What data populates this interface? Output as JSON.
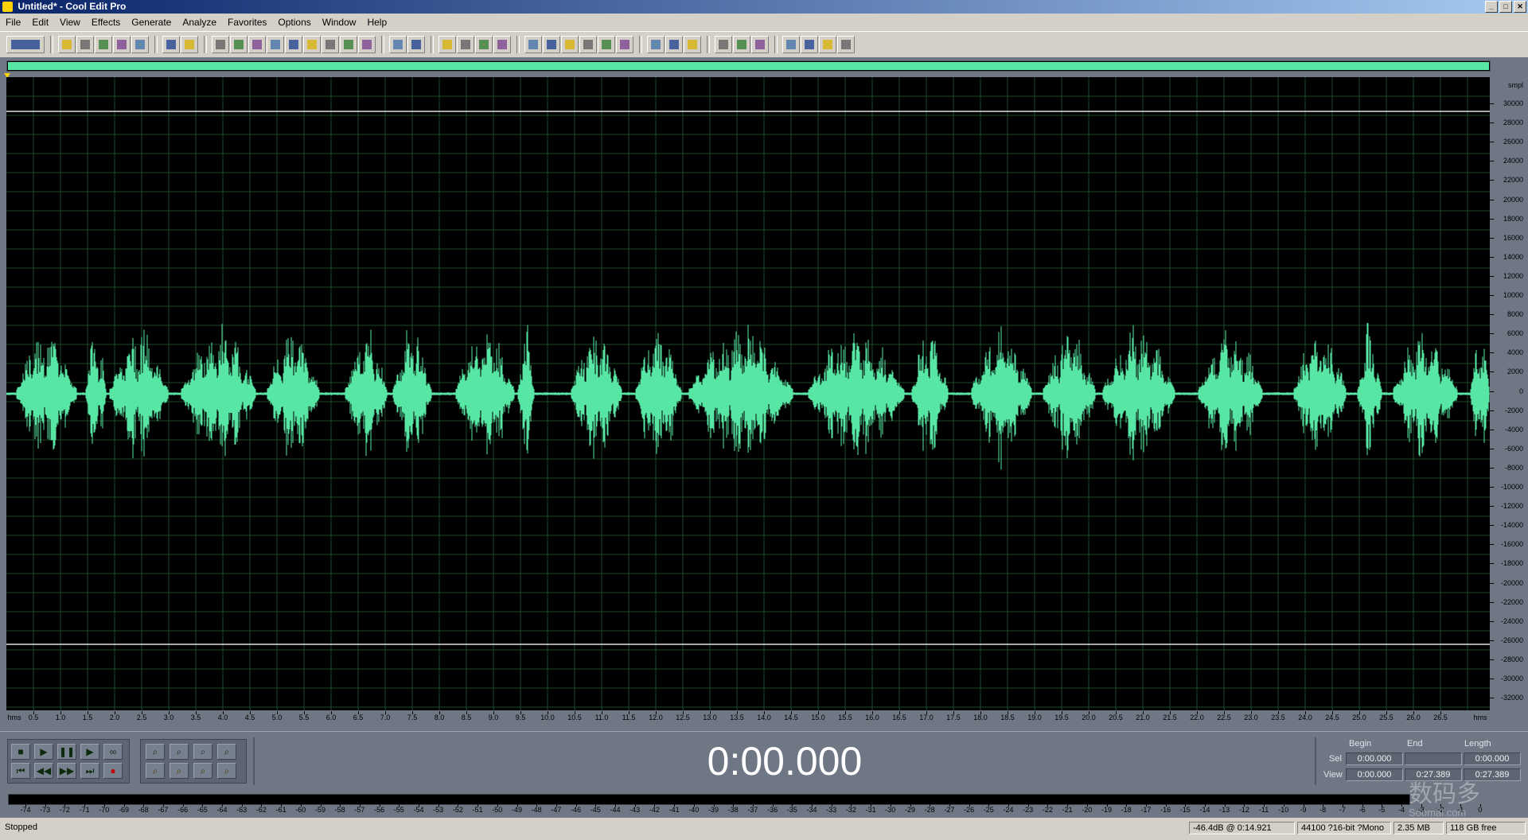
{
  "window": {
    "title": "Untitled* - Cool Edit Pro",
    "icon": "cool-edit-app-icon",
    "controls": [
      "_",
      "□",
      "✕"
    ]
  },
  "menu": [
    "File",
    "Edit",
    "View",
    "Effects",
    "Generate",
    "Analyze",
    "Favorites",
    "Options",
    "Window",
    "Help"
  ],
  "toolbar": {
    "icons": [
      "mode-switch-icon",
      "new-icon",
      "open-icon",
      "save-icon",
      "save-as-icon",
      "close-icon",
      "undo-icon",
      "redo-icon",
      "repeat-icon",
      "copy-icon",
      "copy-new-icon",
      "cut-icon",
      "paste-icon",
      "paste-new-icon",
      "mix-paste-icon",
      "crop-icon",
      "trim-icon",
      "zoom-selection-icon",
      "envelope-icon",
      "waveform-view-icon",
      "spectral-view-icon",
      "loop-icon",
      "cue-list-icon",
      "settings-icon",
      "snap-icon",
      "time-format-icon",
      "display-icon",
      "metronome-icon",
      "info-icon",
      "frequency-analysis-icon",
      "statistics-icon",
      "help-icon",
      "scripts-icon",
      "amplify-icon",
      "normalize-icon",
      "noise-reduction-icon",
      "filter-icon",
      "effects-rack-icon",
      "graphic-eq-icon"
    ]
  },
  "waveform": {
    "overview_color": "#58e6a5",
    "wave_color": "#58e6a5",
    "background": "#000000",
    "grid_color": "#1c4a2c",
    "amplitude_unit": "smpl",
    "amplitude_labels": [
      "30000",
      "28000",
      "26000",
      "24000",
      "22000",
      "20000",
      "18000",
      "16000",
      "14000",
      "12000",
      "10000",
      "8000",
      "6000",
      "4000",
      "2000",
      "0",
      "-2000",
      "-4000",
      "-6000",
      "-8000",
      "-10000",
      "-12000",
      "-14000",
      "-16000",
      "-18000",
      "-20000",
      "-22000",
      "-24000",
      "-26000",
      "-28000",
      "-30000",
      "-32000"
    ],
    "time_unit": "hms",
    "time_labels": [
      "0.5",
      "1.0",
      "1.5",
      "2.0",
      "2.5",
      "3.0",
      "3.5",
      "4.0",
      "4.5",
      "5.0",
      "5.5",
      "6.0",
      "6.5",
      "7.0",
      "7.5",
      "8.0",
      "8.5",
      "9.0",
      "9.5",
      "10.0",
      "10.5",
      "11.0",
      "11.5",
      "12.0",
      "12.5",
      "13.0",
      "13.5",
      "14.0",
      "14.5",
      "15.0",
      "15.5",
      "16.0",
      "16.5",
      "17.0",
      "17.5",
      "18.0",
      "18.5",
      "19.0",
      "19.5",
      "20.0",
      "20.5",
      "21.0",
      "21.5",
      "22.0",
      "22.5",
      "23.0",
      "23.5",
      "24.0",
      "24.5",
      "25.0",
      "25.5",
      "26.0",
      "26.5"
    ]
  },
  "transport": {
    "icons": [
      "stop-icon",
      "play-icon",
      "pause-icon",
      "play-to-end-icon",
      "loop-play-icon",
      "go-to-start-icon",
      "rewind-icon",
      "fast-forward-icon",
      "go-to-end-icon",
      "record-icon"
    ],
    "glyphs": [
      "■",
      "▶",
      "❚❚",
      "▶",
      "∞",
      "⏮",
      "◀◀",
      "▶▶",
      "⏭",
      "●"
    ]
  },
  "zoom": {
    "icons": [
      "zoom-in-icon",
      "zoom-out-icon",
      "zoom-full-icon",
      "zoom-in-vertical-icon",
      "zoom-left-icon",
      "zoom-right-icon",
      "zoom-selection-icon",
      "zoom-out-vertical-icon"
    ]
  },
  "time_display": "0:00.000",
  "selection": {
    "headers": {
      "begin": "Begin",
      "end": "End",
      "length": "Length"
    },
    "sel": {
      "label": "Sel",
      "begin": "0:00.000",
      "end": "",
      "length": "0:00.000"
    },
    "view": {
      "label": "View",
      "begin": "0:00.000",
      "end": "0:27.389",
      "length": "0:27.389"
    }
  },
  "level_labels": [
    "-74",
    "-73",
    "-72",
    "-71",
    "-70",
    "-69",
    "-68",
    "-67",
    "-66",
    "-65",
    "-64",
    "-63",
    "-62",
    "-61",
    "-60",
    "-59",
    "-58",
    "-57",
    "-56",
    "-55",
    "-54",
    "-53",
    "-52",
    "-51",
    "-50",
    "-49",
    "-48",
    "-47",
    "-46",
    "-45",
    "-44",
    "-43",
    "-42",
    "-41",
    "-40",
    "-39",
    "-38",
    "-37",
    "-36",
    "-35",
    "-34",
    "-33",
    "-32",
    "-31",
    "-30",
    "-29",
    "-28",
    "-27",
    "-26",
    "-25",
    "-24",
    "-23",
    "-22",
    "-21",
    "-20",
    "-19",
    "-18",
    "-17",
    "-16",
    "-15",
    "-14",
    "-13",
    "-12",
    "-11",
    "-10",
    "-9",
    "-8",
    "-7",
    "-6",
    "-5",
    "-4",
    "-3",
    "-2",
    "-1",
    "0"
  ],
  "status": {
    "state": "Stopped",
    "level": "-46.4dB @  0:14.921",
    "format": "44100 ?16-bit ?Mono",
    "size": "2.35 MB",
    "free": "118 GB free"
  },
  "watermark": {
    "line1": "数码多",
    "line2": "Soomal.com"
  }
}
